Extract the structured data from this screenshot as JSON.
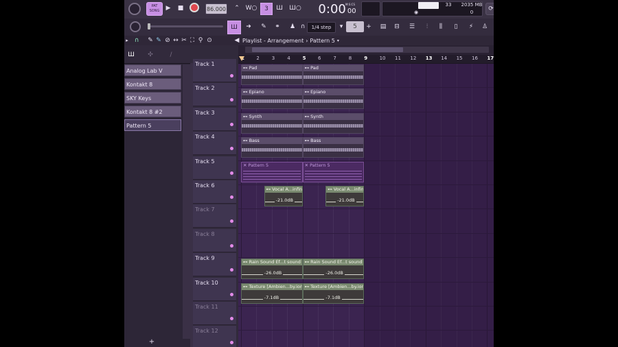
{
  "transport": {
    "pat_song": "PAT",
    "song_label": "SONG",
    "tempo": "86.000",
    "time": "0:00",
    "time_small": "00",
    "time_unit": "M:S:CS",
    "cpu_value": "33",
    "ram_value": "2035 MB",
    "poly_value": "0"
  },
  "toolbar2": {
    "snap": "1/4 step",
    "step_value": "5"
  },
  "menubar": {
    "title": "Playlist - Arrangement",
    "pattern": "Pattern 5"
  },
  "rack": {
    "items": [
      {
        "label": "Analog Lab V"
      },
      {
        "label": "Kontakt 8"
      },
      {
        "label": "SKY Keys"
      },
      {
        "label": "Kontakt 8 #2"
      },
      {
        "label": "Pattern 5"
      }
    ],
    "add_label": "+"
  },
  "header_tabs": {
    "note": "NOTE",
    "loop": "LOOP",
    "pat": "PAT"
  },
  "tracks": [
    {
      "label": "Track 1"
    },
    {
      "label": "Track 2"
    },
    {
      "label": "Track 3"
    },
    {
      "label": "Track 4"
    },
    {
      "label": "Track 5"
    },
    {
      "label": "Track 6"
    },
    {
      "label": "Track 7"
    },
    {
      "label": "Track 8"
    },
    {
      "label": "Track 9"
    },
    {
      "label": "Track 10"
    },
    {
      "label": "Track 11"
    },
    {
      "label": "Track 12"
    }
  ],
  "ruler": [
    "1",
    "2",
    "3",
    "4",
    "5",
    "6",
    "7",
    "8",
    "9",
    "10",
    "11",
    "12",
    "13",
    "14",
    "15",
    "16",
    "17"
  ],
  "clips": {
    "pad": "Pad",
    "epiano": "Epiano",
    "synth": "Synth",
    "bass": "Bass",
    "pattern": "Pattern 5",
    "vocal": "Vocal A...infinite)",
    "vocal_db": "-21.0dB",
    "rain": "Rain Sound Ef...t sound Effect",
    "rain_db": "-26.0dB",
    "texture": "Texture [Ambien...by.ionfinite",
    "texture_db": "-7.1dB"
  },
  "colors": {
    "accent": "#c78fe3",
    "playlist_bg": "#3b2450",
    "clip_header": "#5b4d6a",
    "automation_header": "#7a8a70"
  }
}
